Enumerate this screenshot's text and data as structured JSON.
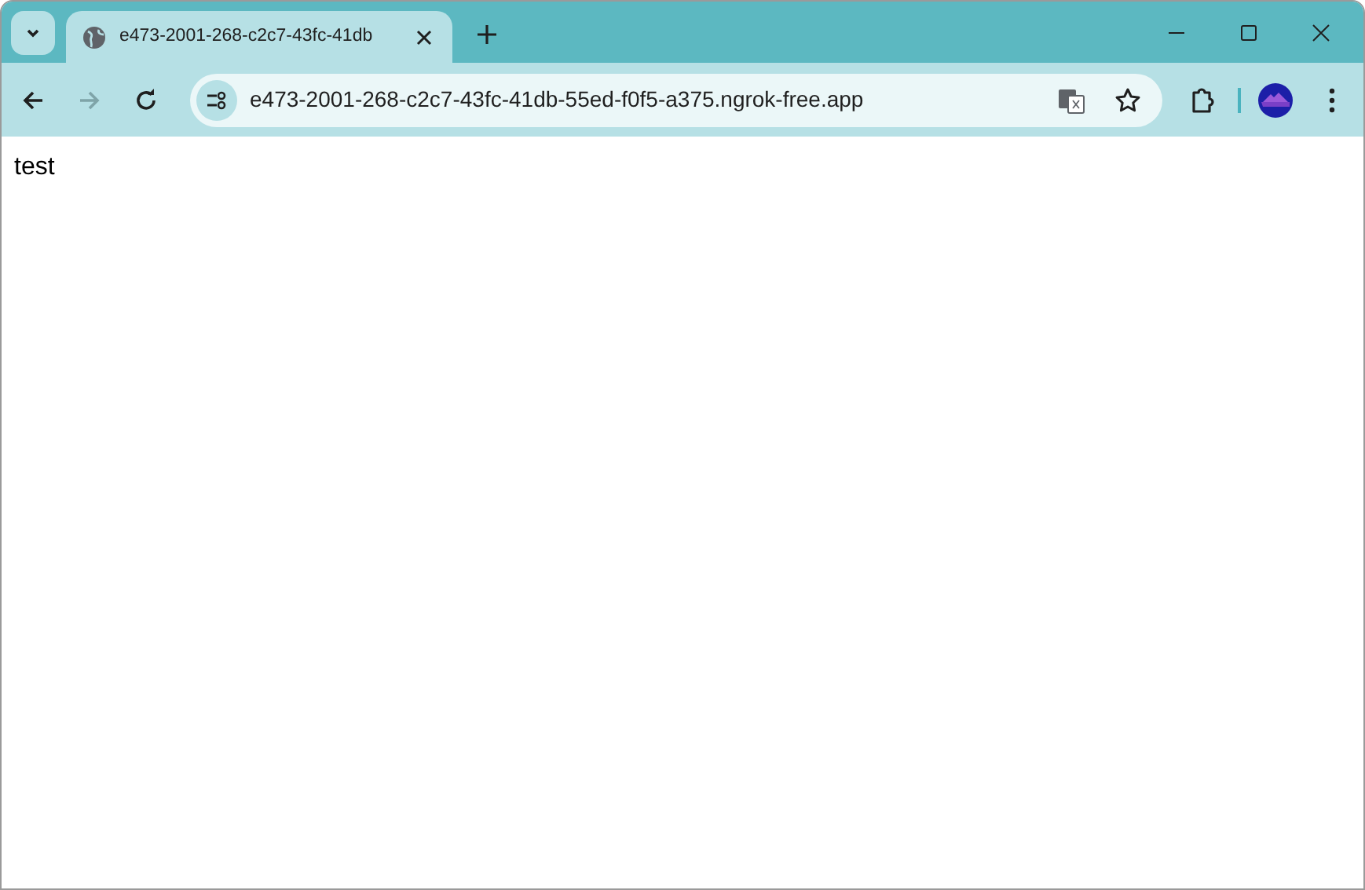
{
  "tabs": [
    {
      "title": "e473-2001-268-c2c7-43fc-41db",
      "selected": true
    }
  ],
  "toolbar": {
    "back_disabled": false,
    "forward_disabled": true
  },
  "address_bar": {
    "url": "e473-2001-268-c2c7-43fc-41db-55ed-f0f5-a375.ngrok-free.app"
  },
  "page": {
    "text": "test"
  }
}
